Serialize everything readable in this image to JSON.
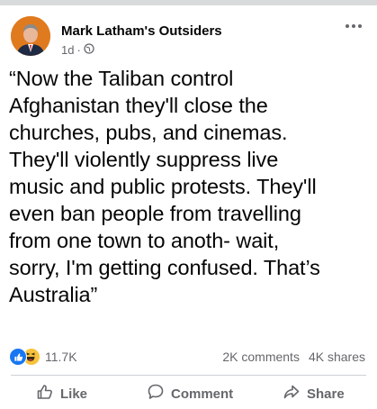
{
  "post": {
    "page_name": "Mark Latham's Outsiders",
    "time": "1d",
    "separator": "·",
    "privacy_icon": "globe-icon",
    "text_lines": [
      "“Now the Taliban control",
      "Afghanistan they'll close the",
      "churches, pubs, and cinemas.",
      "They'll violently suppress live",
      "music and public protests. They'll",
      "even ban people from travelling",
      "from one town to anoth- wait,",
      "sorry, I'm getting confused. That’s",
      "Australia”"
    ]
  },
  "stats": {
    "reactions": [
      "like-reaction-icon",
      "haha-reaction-icon"
    ],
    "reaction_count": "11.7K",
    "comments": "2K comments",
    "shares": "4K shares"
  },
  "actions": {
    "like": "Like",
    "comment": "Comment",
    "share": "Share"
  },
  "colors": {
    "like_blue": "#1877f2",
    "haha_yellow": "#f7c33c",
    "secondary_text": "#65676b",
    "avatar_bg": "#e07a1f"
  }
}
